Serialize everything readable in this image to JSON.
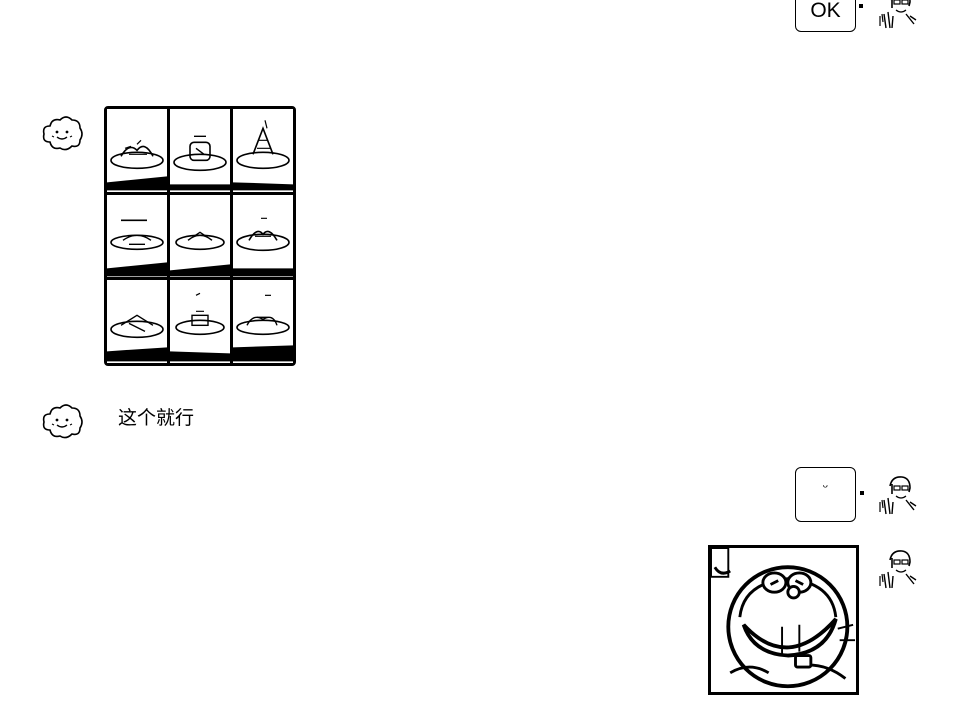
{
  "messages": {
    "ok_bubble": {
      "text": "OK"
    },
    "reply_text": {
      "text": "这个就行"
    },
    "emoji_bubble": {
      "text": "ᵕ"
    },
    "food_grid": {
      "cells": [
        "dish-1",
        "dish-2",
        "dish-3",
        "dish-4",
        "dish-5",
        "dish-6",
        "dish-7",
        "dish-8",
        "dish-9"
      ]
    }
  },
  "avatars": {
    "self": "man-glasses-avatar",
    "other": "cloud-face-avatar"
  },
  "colors": {
    "ink": "#000000",
    "background": "#ffffff"
  }
}
